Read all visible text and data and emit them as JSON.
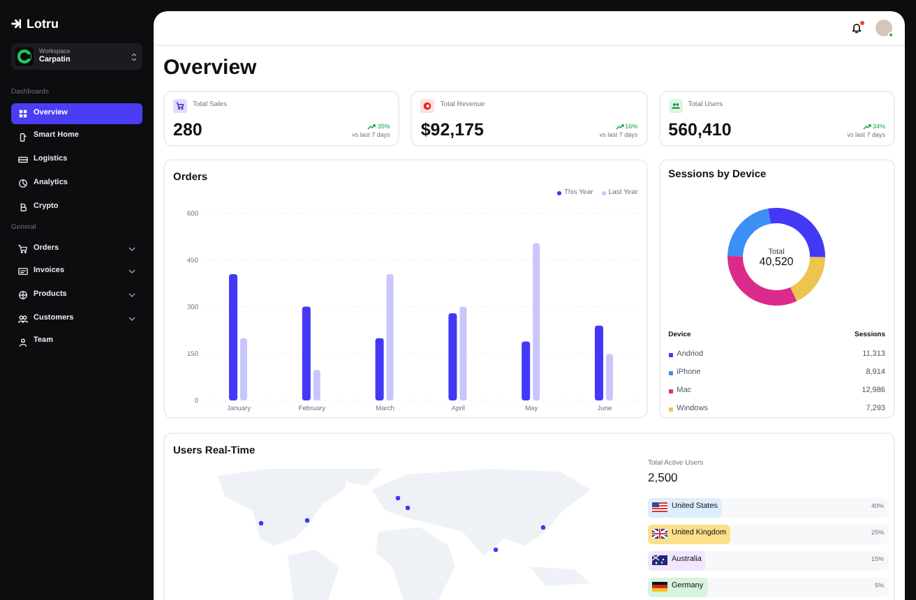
{
  "sidebar": {
    "logo": "Lotru",
    "workspace": {
      "label": "Workspace",
      "name": "Carpatin"
    },
    "sections": [
      {
        "title": "Dashboards",
        "items": [
          {
            "label": "Overview",
            "selected": true
          },
          {
            "label": "Smart Home",
            "selected": false
          },
          {
            "label": "Logistics",
            "selected": false
          },
          {
            "label": "Analytics",
            "selected": false
          },
          {
            "label": "Crypto",
            "selected": false
          }
        ]
      },
      {
        "title": "General",
        "items": [
          {
            "label": "Orders",
            "selected": false,
            "expanded": false
          },
          {
            "label": "Invoices",
            "selected": false,
            "expanded": false
          },
          {
            "label": "Products",
            "selected": false,
            "expanded": false
          },
          {
            "label": "Customers",
            "selected": false,
            "expanded": false
          },
          {
            "label": "Team",
            "selected": false
          }
        ]
      }
    ]
  },
  "header": {
    "notifications_unread": true,
    "user_online": true
  },
  "page_title": "Overview",
  "stats": [
    {
      "title": "Total Sales",
      "value": "280",
      "change": "35%",
      "period": "vs last 7 days",
      "color": "#e0dcff"
    },
    {
      "title": "Total Revenue",
      "value": "$92,175",
      "change": "16%",
      "period": "vs last 7 days",
      "color": "#fde0e0"
    },
    {
      "title": "Total Users",
      "value": "560,410",
      "change": "34%",
      "period": "vs last 7 days",
      "color": "#dcf5e3"
    }
  ],
  "orders": {
    "title": "Orders",
    "chart_data": {
      "type": "bar",
      "categories": [
        "January",
        "February",
        "March",
        "April",
        "May",
        "June"
      ],
      "ylim": [
        0,
        600
      ],
      "grid": true,
      "yticks": [
        0,
        150,
        300,
        450,
        600
      ],
      "series": [
        {
          "name": "This Year",
          "color": "#4338f5",
          "values": [
            405,
            301,
            200,
            280,
            189,
            240
          ]
        },
        {
          "name": "Last Year",
          "color": "#c9c6fb",
          "values": [
            200,
            98,
            405,
            301,
            505,
            149
          ]
        }
      ]
    }
  },
  "sessions": {
    "title": "Sessions by Device",
    "center_label": "Total",
    "center_value": "40,520",
    "columns": [
      "Device",
      "Sessions"
    ],
    "rows": [
      {
        "device": "Andriod",
        "sessions": "11,313",
        "color": "#4338f5"
      },
      {
        "device": "iPhone",
        "sessions": "8,914",
        "color": "#3b8ff5"
      },
      {
        "device": "Mac",
        "sessions": "12,986",
        "color": "#db2a8a"
      },
      {
        "device": "Windows",
        "sessions": "7,293",
        "color": "#ecc44f"
      }
    ]
  },
  "realtime": {
    "title": "Users Real-Time",
    "total_label": "Total Active Users",
    "total_value": "2,500",
    "countries": [
      {
        "name": "United States",
        "percent": "40%",
        "color": "#ddeefe"
      },
      {
        "name": "United Kingdom",
        "percent": "25%",
        "color": "#fbe08a"
      },
      {
        "name": "Australia",
        "percent": "15%",
        "color": "#f1e6fd"
      },
      {
        "name": "Germany",
        "percent": "5%",
        "color": "#d8f3df"
      }
    ]
  }
}
